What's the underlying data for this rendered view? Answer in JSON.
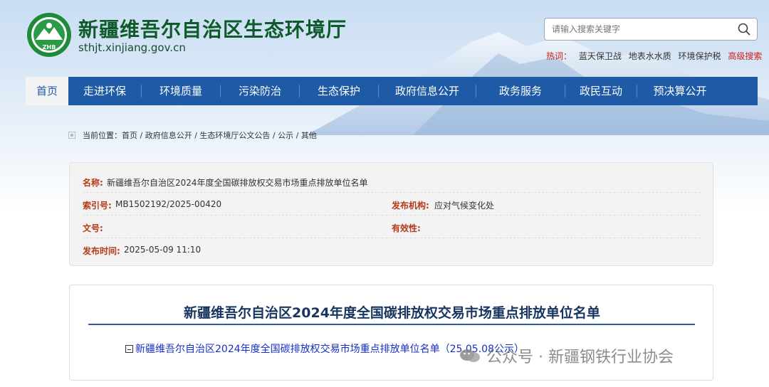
{
  "header": {
    "title": "新疆维吾尔自治区生态环境厅",
    "url": "sthjt.xinjiang.gov.cn",
    "logo_text": "ZHB"
  },
  "search": {
    "placeholder": "请输入搜索关键字"
  },
  "hot_words": {
    "label": "热词：",
    "items": [
      "蓝天保卫战",
      "地表水水质",
      "环境保护税"
    ],
    "advanced": "高级搜索"
  },
  "nav": {
    "items": [
      "首页",
      "走进环保",
      "环境质量",
      "污染防治",
      "生态保护",
      "政府信息公开",
      "政务服务",
      "政民互动",
      "预决算公开"
    ]
  },
  "breadcrumb": {
    "label": "当前位置：",
    "items": [
      "首页",
      "政府信息公开",
      "生态环境厅公文公告",
      "公示",
      "其他"
    ],
    "sep": " / "
  },
  "info": {
    "name_key": "名称:",
    "name_val": "新疆维吾尔自治区2024年度全国碳排放权交易市场重点排放单位名单",
    "index_key": "索引号:",
    "index_val": "MB1502192/2025-00420",
    "org_key": "发布机构:",
    "org_val": "应对气候变化处",
    "docno_key": "文号:",
    "docno_val": "",
    "valid_key": "有效性:",
    "valid_val": "",
    "date_key": "发布时间:",
    "date_val": "2025-05-09 11:10"
  },
  "content": {
    "title": "新疆维吾尔自治区2024年度全国碳排放权交易市场重点排放单位名单",
    "attachment": "新疆维吾尔自治区2024年度全国碳排放权交易市场重点排放单位名单（25.05.08公示）"
  },
  "watermark": {
    "text": "公众号 · 新疆钢铁行业协会"
  },
  "colors": {
    "nav_bg": "#1e5aa6",
    "title_green": "#0d5a2a",
    "key_red": "#b33a1a",
    "hot_red": "#d0201a",
    "link_blue": "#1a2fc4"
  }
}
